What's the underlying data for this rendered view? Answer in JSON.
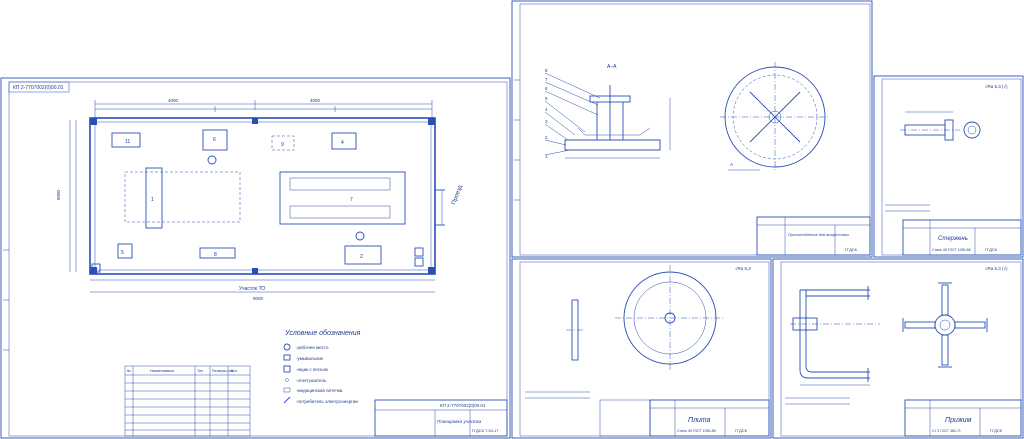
{
  "sheet1": {
    "stamp_code": "КП 2-7707002(0)00.01",
    "area_label": "Участок ТО",
    "drive_label": "Проезд",
    "title_block_name": "Планировка участка",
    "title_block_group": "ГГДСК  Т.34-17",
    "dim_total": "9000",
    "dim_height": "6000",
    "equipment_numbers": [
      "1",
      "2",
      "3",
      "4",
      "5",
      "6",
      "7",
      "8",
      "9",
      "11"
    ],
    "legend_title": "Условные обозначения",
    "legend_items": [
      "-рабочее место",
      "-умывальник",
      "-ящик с песком",
      "-огнетушитель",
      "-медицинская аптечка",
      "-потребитель электроэнергии"
    ],
    "spec_header": [
      "№",
      "Наименование",
      "Тип",
      "Размеры, мм",
      "Кол."
    ]
  },
  "sheet2": {
    "section_label": "А–А",
    "arrow_label": "А",
    "title_block_name": "Приспособление для выпрессовки",
    "title_block_group": "ГГДСК",
    "parts": [
      "8",
      "7",
      "6",
      "5",
      "4",
      "3",
      "2",
      "1"
    ]
  },
  "sheet3": {
    "title_block_name": "Стержень",
    "material": "Сталь 45 ГОСТ 1050-88",
    "title_block_group": "ГГДСК",
    "roughness": "√Ra 6,3 (√)"
  },
  "sheet4": {
    "title_block_name": "Плита",
    "material": "Сталь 45 ГОСТ 1050-88",
    "title_block_group": "ГГДСК",
    "roughness": "√Ra 6,3"
  },
  "sheet5": {
    "title_block_name": "Прижим",
    "material": "Ст 3 ГОСТ 380-71",
    "title_block_group": "ГГДСК",
    "roughness": "√Ra 6,3 (√)"
  }
}
